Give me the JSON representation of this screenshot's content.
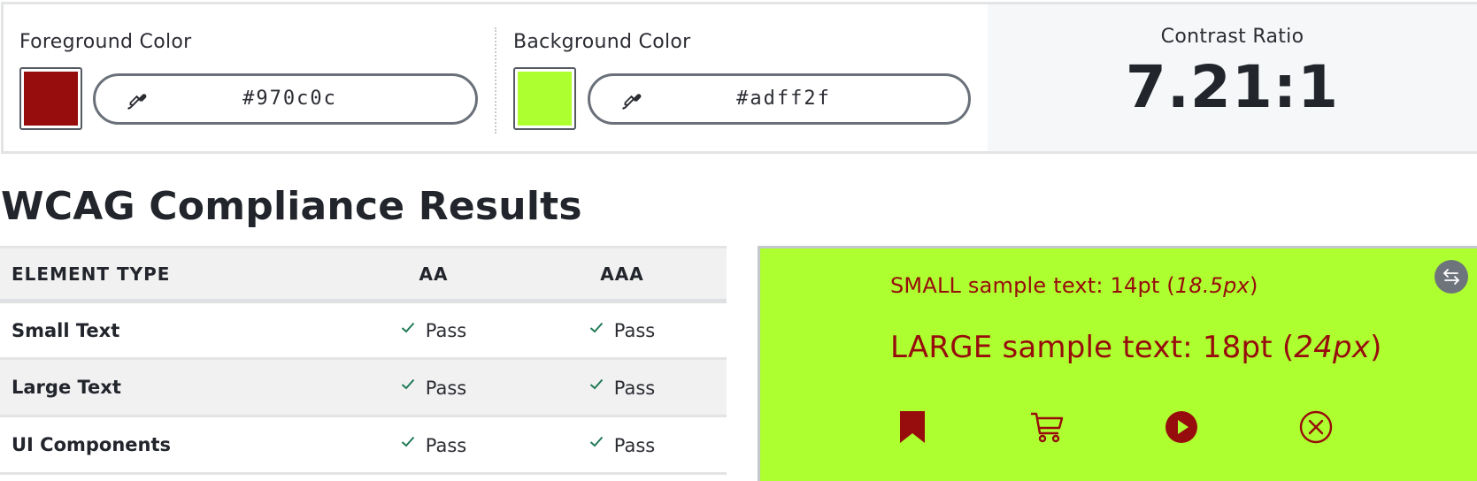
{
  "colors": {
    "foreground": "#970c0c",
    "background": "#adff2f",
    "pass_check": "#1f7a55",
    "swap_button": "#6e747c"
  },
  "foreground": {
    "label": "Foreground Color",
    "hex": "#970c0c",
    "eyedropper_icon": "eyedropper-icon"
  },
  "background": {
    "label": "Background Color",
    "hex": "#adff2f",
    "eyedropper_icon": "eyedropper-icon"
  },
  "contrast": {
    "label": "Contrast Ratio",
    "value": "7.21:1"
  },
  "wcag": {
    "title": "WCAG Compliance Results",
    "columns": [
      "ELEMENT TYPE",
      "AA",
      "AAA"
    ],
    "rows": [
      {
        "type": "Small Text",
        "aa": "Pass",
        "aaa": "Pass"
      },
      {
        "type": "Large Text",
        "aa": "Pass",
        "aaa": "Pass"
      },
      {
        "type": "UI Components",
        "aa": "Pass",
        "aaa": "Pass"
      }
    ]
  },
  "preview": {
    "small_prefix": "SMALL sample text: 14pt (",
    "small_px": "18.5px",
    "small_suffix": ")",
    "large_prefix": "LARGE sample text: 18pt (",
    "large_px": "24px",
    "large_suffix": ")",
    "icons": [
      "bookmark-icon",
      "cart-icon",
      "play-icon",
      "close-circle-icon"
    ],
    "swap_icon": "swap-arrows-icon"
  }
}
